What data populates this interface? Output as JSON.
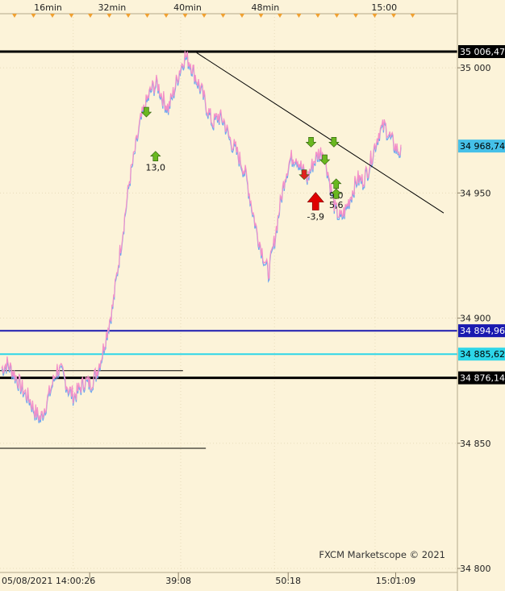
{
  "chart_data": {
    "type": "line",
    "watermark": "FXCM Marketscope © 2021",
    "y_range": [
      34800,
      35020
    ],
    "y_ticks": [
      {
        "value": 35000,
        "label": "35 000"
      },
      {
        "value": 34950,
        "label": "34 950"
      },
      {
        "value": 34900,
        "label": "34 900"
      },
      {
        "value": 34850,
        "label": "34 850"
      },
      {
        "value": 34800,
        "label": "34 800"
      }
    ],
    "top_time_labels": [
      "16min",
      "32min",
      "40min",
      "48min",
      "15:00"
    ],
    "bottom_time_labels": [
      "05/08/2021 14:00:26",
      "39:08",
      "50:18",
      "15:01:09"
    ],
    "series": [
      {
        "color": "#f48fc8",
        "values": [
          34880,
          34882,
          34879,
          34875,
          34871,
          34868,
          34863,
          34860,
          34866,
          34873,
          34880,
          34878,
          34872,
          34869,
          34872,
          34875,
          34874,
          34878,
          34885,
          34895,
          34905,
          34922,
          34938,
          34955,
          34967,
          34979,
          34986,
          34992,
          34994,
          34988,
          34984,
          34991,
          34999,
          35005,
          35002,
          34996,
          34991,
          34984,
          34978,
          34981,
          34979,
          34972,
          34968,
          34963,
          34957,
          34945,
          34934,
          34926,
          34918,
          34930,
          34944,
          34957,
          34964,
          34965,
          34960,
          34956,
          34962,
          34966,
          34967,
          34955,
          34944,
          34940,
          34944,
          34950,
          34956,
          34955,
          34960,
          34968,
          34975,
          34977,
          34972,
          34968,
          34966
        ]
      }
    ],
    "price_lines": [
      {
        "value": 35006.47,
        "label": "35 006,47",
        "color": "#000000",
        "badge_bg": "#000000",
        "badge_fg": "#ffffff"
      },
      {
        "value": 34968.74,
        "label": "34 968,74",
        "color": null,
        "badge_bg": "#45c0e8",
        "badge_fg": "#000000"
      },
      {
        "value": 34894.96,
        "label": "34 894,96",
        "color": "#1a1ab0",
        "badge_bg": "#1a1ab0",
        "badge_fg": "#ffffff"
      },
      {
        "value": 34885.62,
        "label": "34 885,62",
        "color": "#2dd6e8",
        "badge_bg": "#2dd6e8",
        "badge_fg": "#000000"
      },
      {
        "value": 34876.14,
        "label": "34 876,14",
        "color": "#000000",
        "badge_bg": "#000000",
        "badge_fg": "#ffffff"
      }
    ],
    "partial_lines": [
      {
        "value": 34879,
        "x_end_fraction": 0.4
      },
      {
        "value": 34848,
        "x_end_fraction": 0.45
      }
    ],
    "trendline": {
      "from_fraction": [
        0.43,
        35006
      ],
      "to_fraction": [
        0.97,
        34942
      ]
    },
    "markers": [
      {
        "kind": "down",
        "color": "#6ab820",
        "x_fraction": 0.32,
        "value": 34981
      },
      {
        "kind": "up",
        "color": "#6ab820",
        "x_fraction": 0.34,
        "value": 34966,
        "label": "13,0"
      },
      {
        "kind": "down",
        "color": "#6ab820",
        "x_fraction": 0.68,
        "value": 34969
      },
      {
        "kind": "down",
        "color": "#6ab820",
        "x_fraction": 0.71,
        "value": 34962
      },
      {
        "kind": "down",
        "color": "#6ab820",
        "x_fraction": 0.73,
        "value": 34969
      },
      {
        "kind": "down",
        "color": "#e02020",
        "x_fraction": 0.665,
        "value": 34956
      },
      {
        "kind": "up-big",
        "color": "#e00000",
        "x_fraction": 0.69,
        "value": 34947,
        "label": "-3,9"
      },
      {
        "kind": "up",
        "color": "#6ab820",
        "x_fraction": 0.735,
        "value": 34955,
        "label": "9,0"
      },
      {
        "kind": "up",
        "color": "#6ab820",
        "x_fraction": 0.735,
        "value": 34951,
        "label": "5,6"
      }
    ]
  }
}
